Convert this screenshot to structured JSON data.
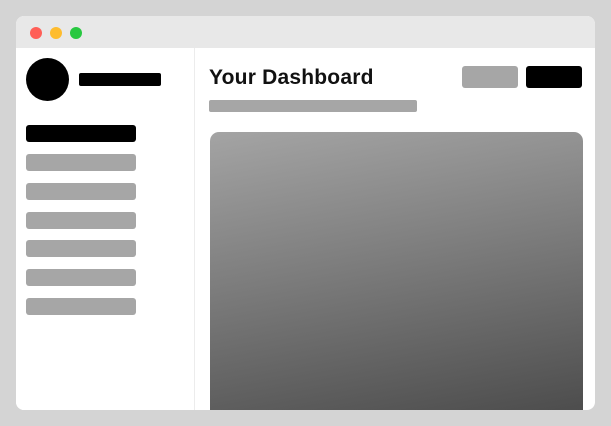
{
  "window": {
    "controls": [
      {
        "name": "close",
        "color": "#ff5f57"
      },
      {
        "name": "minimize",
        "color": "#febc2e"
      },
      {
        "name": "maximize",
        "color": "#28c840"
      }
    ]
  },
  "colors": {
    "placeholder_dark": "#000000",
    "placeholder_light": "#a6a6a6",
    "background": "#d4d4d4",
    "titlebar": "#e8e8e8"
  },
  "sidebar": {
    "avatar_icon": "avatar-placeholder",
    "nav_items": [
      {
        "id": "nav-item-1",
        "active": true
      },
      {
        "id": "nav-item-2",
        "active": false
      },
      {
        "id": "nav-item-3",
        "active": false
      },
      {
        "id": "nav-item-4",
        "active": false
      },
      {
        "id": "nav-item-5",
        "active": false
      },
      {
        "id": "nav-item-6",
        "active": false
      },
      {
        "id": "nav-item-7",
        "active": false
      }
    ]
  },
  "main": {
    "title": "Your Dashboard",
    "actions": [
      {
        "id": "secondary-action",
        "style": "secondary"
      },
      {
        "id": "primary-action",
        "style": "primary"
      }
    ]
  }
}
